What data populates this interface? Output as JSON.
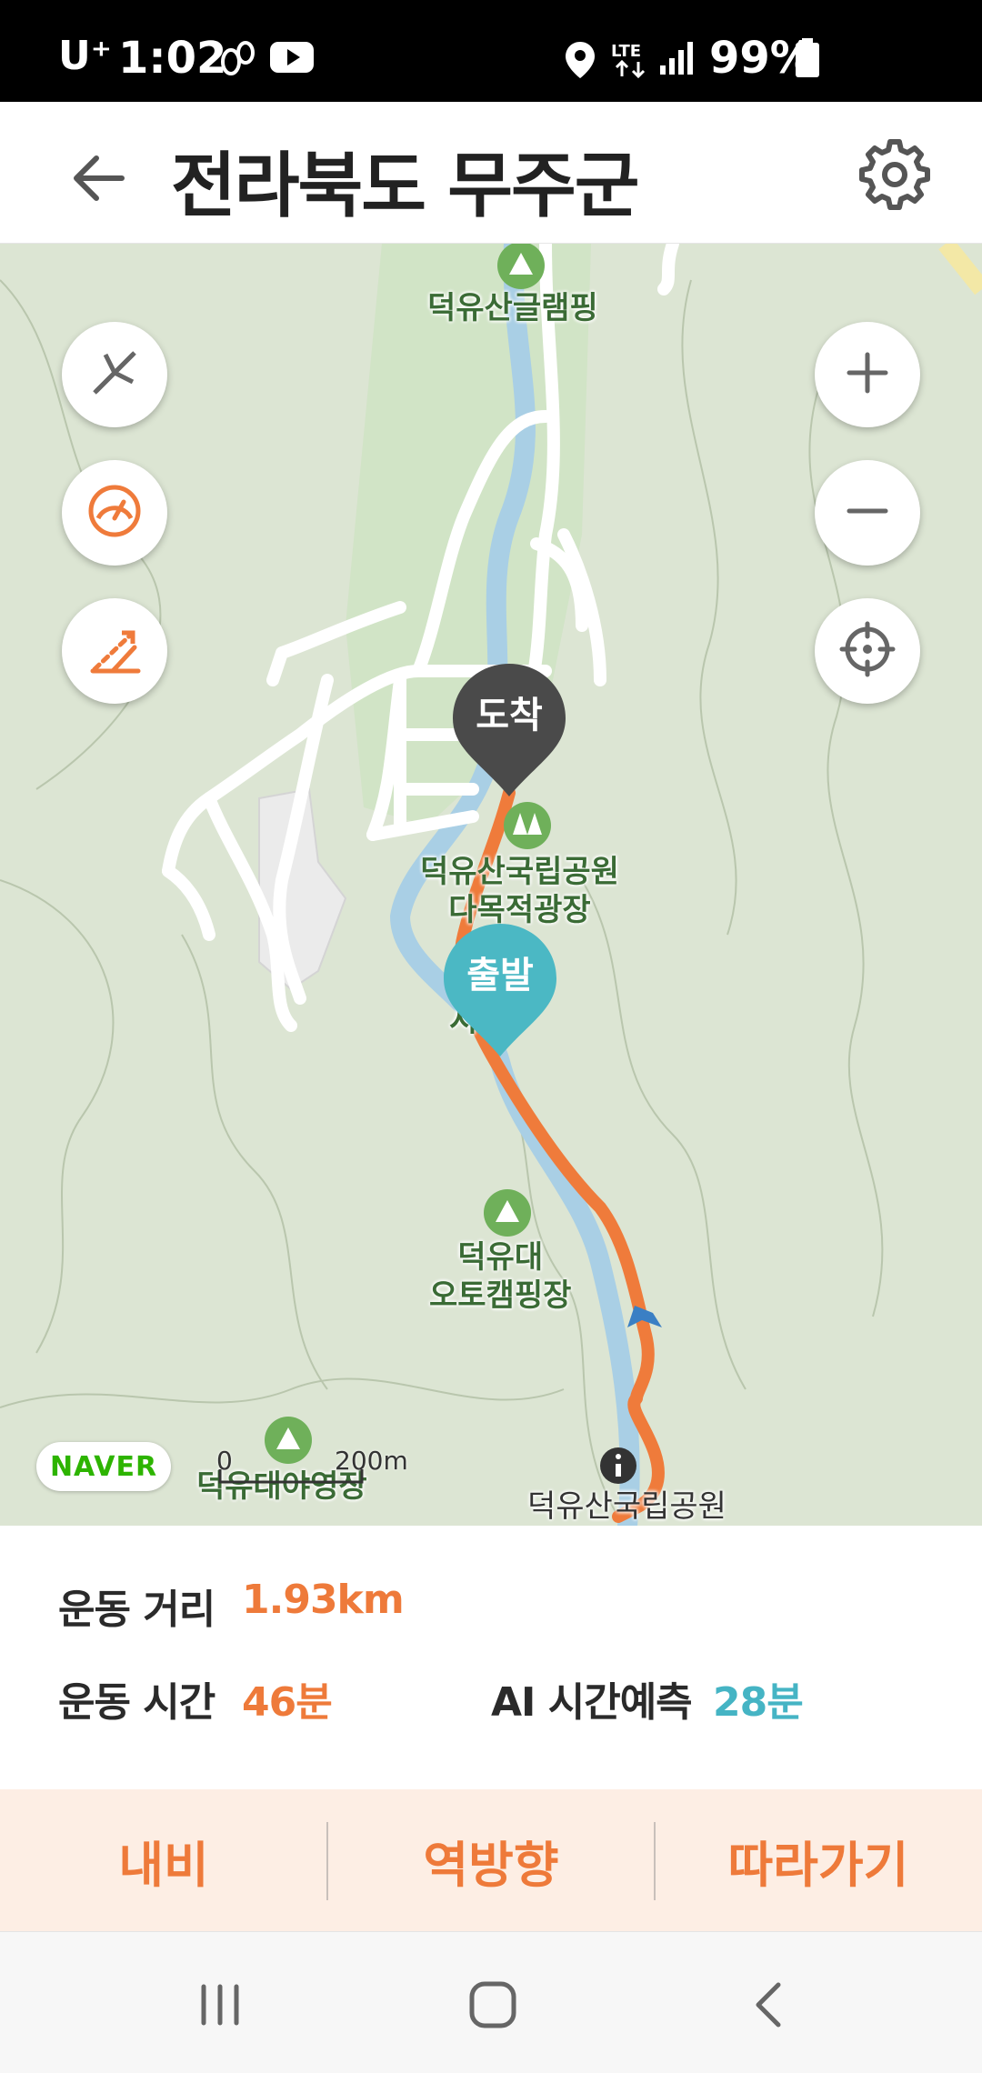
{
  "status_bar": {
    "carrier": "U⁺",
    "time": "1:02",
    "battery": "99%",
    "icons": [
      "steps-icon",
      "youtube-icon",
      "location-icon",
      "lte-icon",
      "signal-icon",
      "battery-icon"
    ]
  },
  "header": {
    "title": "전라북도 무주군",
    "back_icon": "arrow-left-icon",
    "settings_icon": "gear-icon"
  },
  "map": {
    "labels": {
      "glamping": "덕유산글램핑",
      "park_plaza_1": "덕유산국립공원",
      "park_plaza_2": "다목적광장",
      "autocamp_1": "덕유대",
      "autocamp_2": "오토캠핑장",
      "yeongjang": "덕유대야영장",
      "park_info": "덕유산국립공원",
      "partial": "시"
    },
    "pins": {
      "arrival": "도착",
      "departure": "출발"
    },
    "scale": {
      "start": "0",
      "end": "200m"
    },
    "brand": "NAVER",
    "controls": {
      "left": [
        "compass-off-icon",
        "speedometer-icon",
        "elevation-icon"
      ],
      "right": [
        "zoom-in-icon",
        "zoom-out-icon",
        "locate-icon"
      ]
    },
    "route_color": "#ef7b3b",
    "departure_color": "#4bb8c4",
    "arrival_color": "#4a4a4a"
  },
  "stats": {
    "distance_label": "운동 거리",
    "distance_value": "1.93km",
    "time_label": "운동 시간",
    "time_value": "46분",
    "ai_label": "AI 시간예측",
    "ai_value": "28분",
    "accent": "#ee7a3a",
    "ai_accent": "#45b4c4"
  },
  "actions": [
    "내비",
    "역방향",
    "따라가기"
  ],
  "navbar": [
    "recent-apps-icon",
    "home-icon",
    "back-icon"
  ]
}
